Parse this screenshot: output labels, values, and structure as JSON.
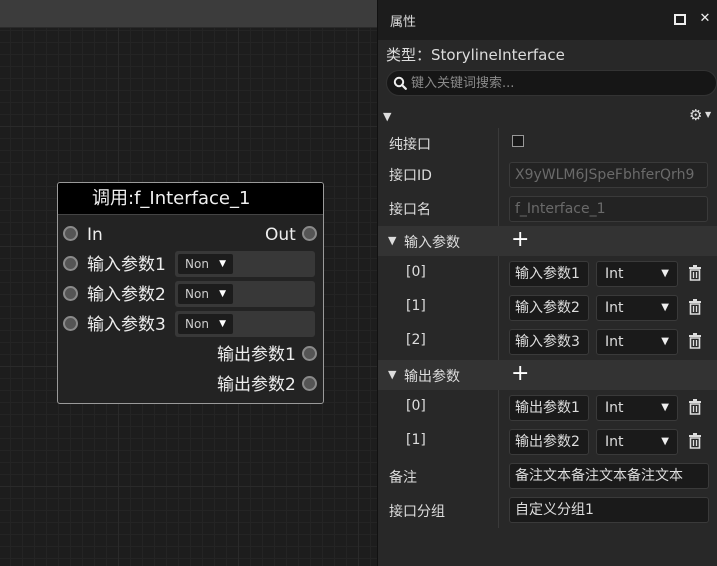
{
  "node": {
    "title": "调用:f_Interface_1",
    "in_label": "In",
    "out_label": "Out",
    "inputs": [
      {
        "label": "输入参数1",
        "type": "Non"
      },
      {
        "label": "输入参数2",
        "type": "Non"
      },
      {
        "label": "输入参数3",
        "type": "Non"
      }
    ],
    "outputs": [
      {
        "label": "输出参数1"
      },
      {
        "label": "输出参数2"
      }
    ]
  },
  "panel": {
    "title": "属性",
    "type_line": "类型：StorylineInterface",
    "search_placeholder": "键入关键词搜索...",
    "pure_interface_label": "纯接口",
    "pure_interface_checked": false,
    "interface_id_label": "接口ID",
    "interface_id_value": "X9yWLM6JSpeFbhferQrh9",
    "interface_name_label": "接口名",
    "interface_name_value": "f_Interface_1",
    "inputs_section": {
      "label": "输入参数",
      "params": [
        {
          "index": "[0]",
          "name": "输入参数1",
          "type": "Int"
        },
        {
          "index": "[1]",
          "name": "输入参数2",
          "type": "Int"
        },
        {
          "index": "[2]",
          "name": "输入参数3",
          "type": "Int"
        }
      ]
    },
    "outputs_section": {
      "label": "输出参数",
      "params": [
        {
          "index": "[0]",
          "name": "输出参数1",
          "type": "Int"
        },
        {
          "index": "[1]",
          "name": "输出参数2",
          "type": "Int"
        }
      ]
    },
    "note_label": "备注",
    "note_value": "备注文本备注文本备注文本",
    "group_label": "接口分组",
    "group_value": "自定义分组1"
  }
}
